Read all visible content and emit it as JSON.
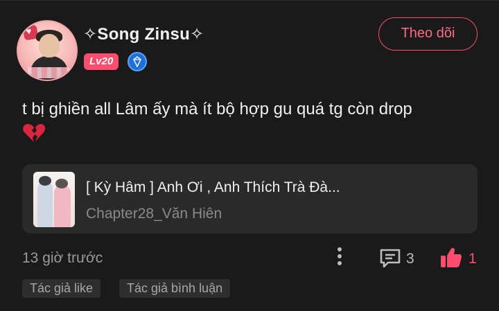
{
  "author": {
    "name": "✧Song Zinsu✧",
    "level": "Lv20",
    "follow_label": "Theo dõi"
  },
  "post": {
    "text": "t bị ghiền all Lâm ấy mà ít bộ hợp gu quá tg còn drop",
    "emoji": "broken-heart-icon"
  },
  "story": {
    "title": "[ Kỳ Hâm ] Anh Ơi , Anh Thích Trà Đà...",
    "chapter": "Chapter28_Văn Hiên"
  },
  "footer": {
    "time": "13 giờ trước",
    "comment_count": "3",
    "like_count": "1",
    "tags": [
      "Tác giả like",
      "Tác giả bình luận"
    ]
  },
  "colors": {
    "accent": "#ff4d6d",
    "background": "#1a1a1a",
    "card": "#2a2a2a",
    "muted_text": "#9a9a9a"
  }
}
